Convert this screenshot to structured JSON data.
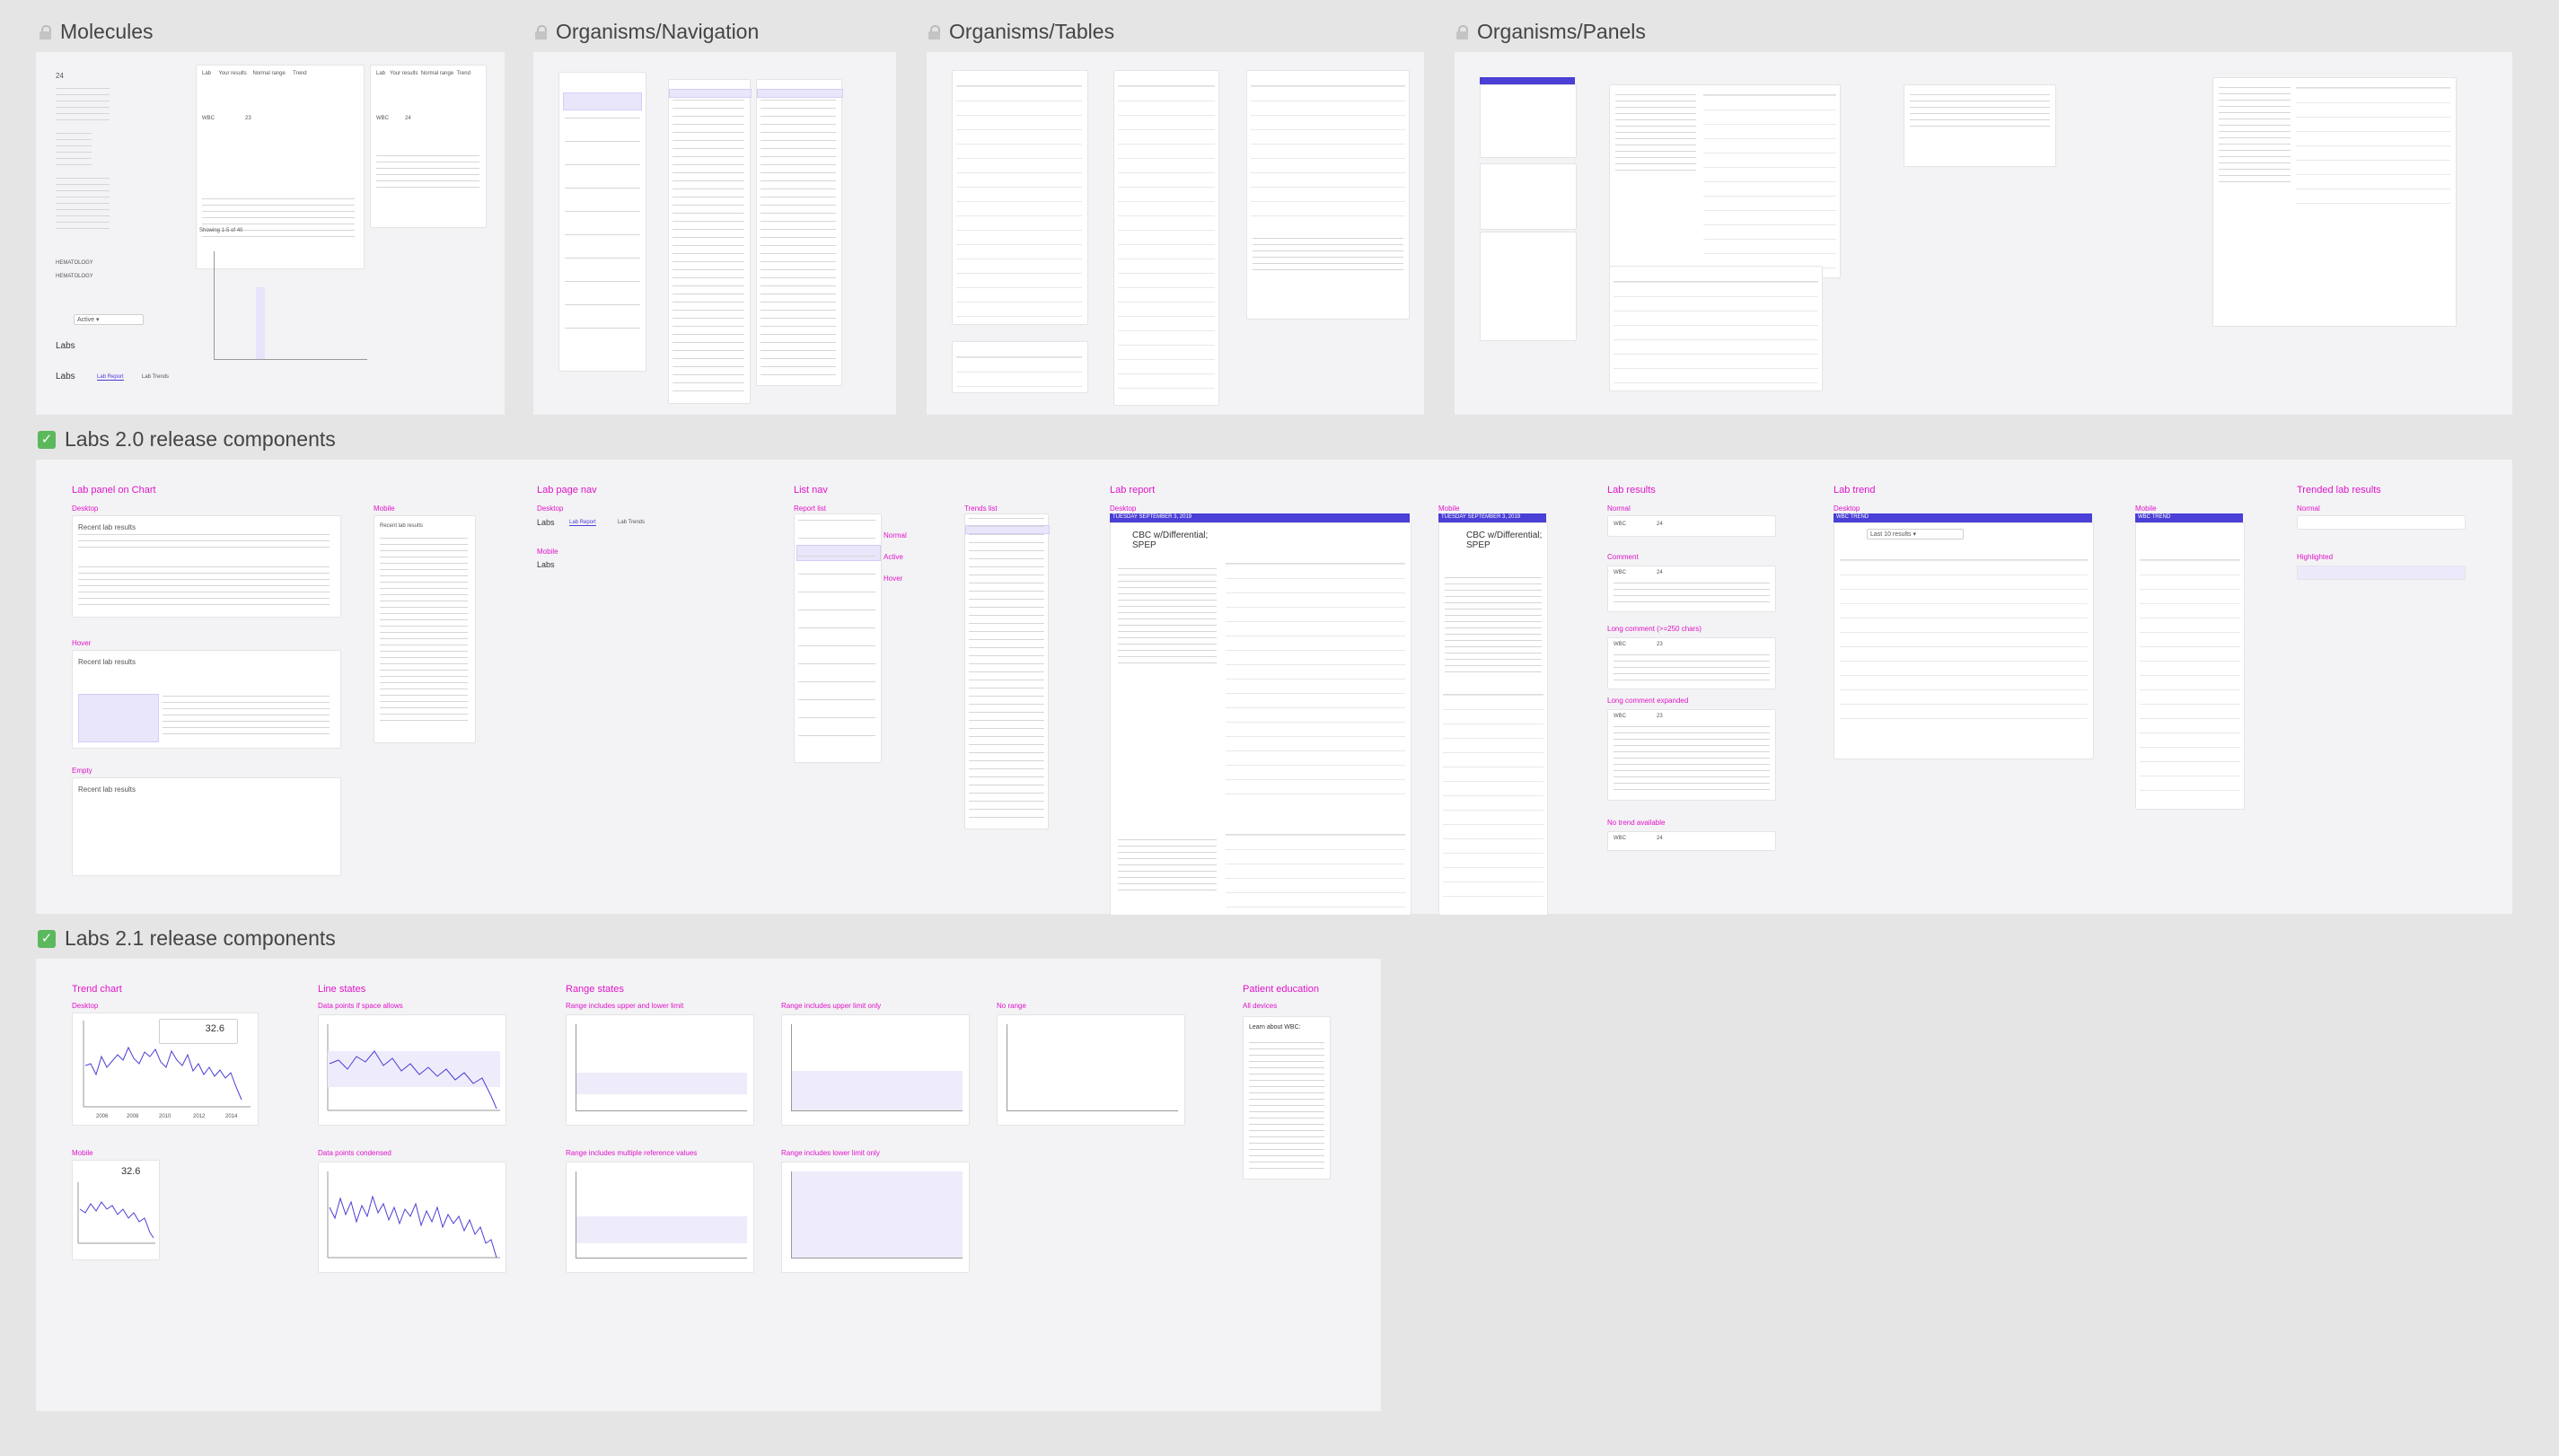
{
  "sections": {
    "molecules": "Molecules",
    "organisms_navigation": "Organisms/Navigation",
    "organisms_tables": "Organisms/Tables",
    "organisms_panels": "Organisms/Panels",
    "labs20": "Labs 2.0 release components",
    "labs21": "Labs 2.1 release components"
  },
  "molecules": {
    "labs1": "Labs",
    "labs2": "Labs",
    "lab_report_tab": "Lab Report",
    "lab_trends_tab": "Lab Trends",
    "showing": "Showing 1-5 of 40",
    "hematology": "HEMATOLOGY",
    "wbc": "WBC",
    "value_23": "23",
    "value_24": "24"
  },
  "labs20": {
    "lab_panel_on_chart": "Lab panel on Chart",
    "desktop1": "Desktop",
    "mobile1": "Mobile",
    "hover": "Hover",
    "empty": "Empty",
    "recent_lab_results": "Recent lab results",
    "lab_page_nav": "Lab page nav",
    "lp_desktop": "Desktop",
    "lp_mobile": "Mobile",
    "labs_title": "Labs",
    "labs_title_mobile": "Labs",
    "lab_report_tab": "Lab Report",
    "lab_trends_tab": "Lab Trends",
    "list_nav": "List nav",
    "report_list": "Report list",
    "normal": "Normal",
    "active": "Active",
    "hover_state": "Hover",
    "trends_list": "Trends list",
    "lab_report": "Lab report",
    "lr_desktop": "Desktop",
    "lr_mobile": "Mobile",
    "report_date": "TUESDAY SEPTEMBER 3, 2019",
    "report_title": "CBC w/Differential; SPEP",
    "report_title_mobile": "CBC w/Differential; SPEP",
    "lab_results": "Lab results",
    "lres_normal": "Normal",
    "comment": "Comment",
    "long_comment": "Long comment (>=250 chars)",
    "long_comment_expanded": "Long comment expanded",
    "no_trend": "No trend available",
    "lab_trend": "Lab trend",
    "lt_desktop": "Desktop",
    "lt_mobile": "Mobile",
    "wbc_trend": "WBC TREND",
    "trended_lab_results": "Trended lab results",
    "tl_normal": "Normal",
    "highlighted": "Highlighted",
    "wbc": "WBC",
    "v24": "24",
    "v23": "23"
  },
  "labs21": {
    "trend_chart": "Trend chart",
    "desktop": "Desktop",
    "mobile": "Mobile",
    "line_states": "Line states",
    "data_points_space": "Data points if space allows",
    "data_points_condensed": "Data points condensed",
    "range_states": "Range states",
    "range_upper_lower": "Range includes upper and lower limit",
    "range_upper_only": "Range includes upper limit only",
    "no_range": "No range",
    "range_multiple": "Range includes multiple reference values",
    "range_lower_only": "Range includes lower limit only",
    "patient_education": "Patient education",
    "all_devices": "All devices",
    "learn_about": "Learn about WBC:",
    "tooltip_value": "32.6",
    "tooltip_value_mobile": "32.6",
    "years": [
      "2006",
      "2008",
      "2010",
      "2012",
      "2014"
    ]
  }
}
